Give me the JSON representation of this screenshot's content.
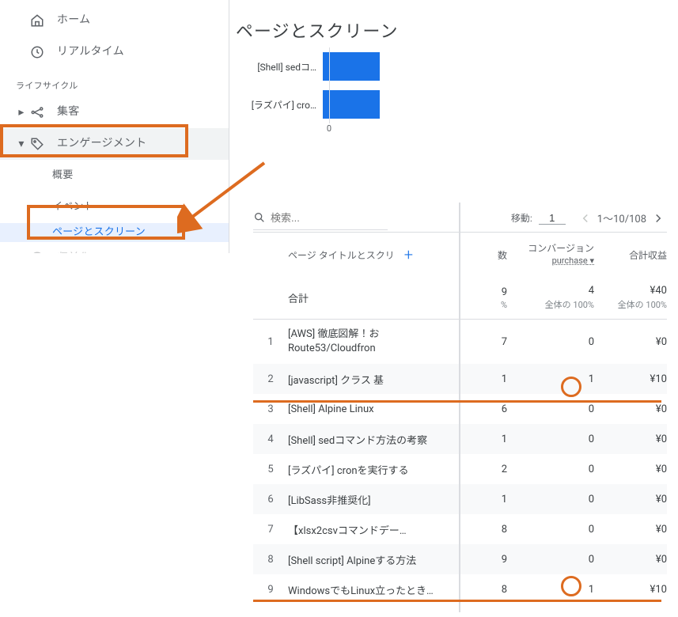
{
  "sidebar": {
    "home": "ホーム",
    "realtime": "リアルタイム",
    "lifecycle_header": "ライフサイクル",
    "acquisition": "集客",
    "engagement": "エンゲージメント",
    "engagement_items": {
      "overview": "概要",
      "events": "イベント",
      "pages_screens": "ページとスクリーン"
    },
    "monetization": "収益化"
  },
  "page_title": "ページとスクリーン",
  "chart_data": {
    "type": "bar",
    "orientation": "horizontal",
    "categories": [
      "[Shell] sedコ…",
      "[ラズパイ] cro…"
    ],
    "values": [
      9,
      9
    ],
    "xlim": [
      0,
      10
    ],
    "ticks": [
      0
    ]
  },
  "table_controls": {
    "search_placeholder": "検索...",
    "move_label": "移動:",
    "move_value": "1",
    "range_label": "1～10/108"
  },
  "table_head": {
    "title_col": "ページ タイトルとスクリ",
    "count_suffix": "数",
    "conversion": "コンバージョン",
    "conversion_sub": "purchase",
    "revenue": "合計収益"
  },
  "table_totals": {
    "label": "合計",
    "count": "9",
    "count_sub": "%",
    "conversion": "4",
    "conversion_sub": "全体の 100%",
    "revenue": "¥40",
    "revenue_sub": "全体の 100%"
  },
  "rows": [
    {
      "idx": "1",
      "title": "[AWS] 徹底図解！お Route53/Cloudfron",
      "count": "7",
      "conv": "0",
      "rev": "¥0",
      "twoline": true
    },
    {
      "idx": "2",
      "title": "[javascript] クラス 基",
      "count": "1",
      "conv": "1",
      "rev": "¥10"
    },
    {
      "idx": "3",
      "title": "[Shell] Alpine Linux",
      "count": "6",
      "conv": "0",
      "rev": "¥0"
    },
    {
      "idx": "4",
      "title": "[Shell] sedコマンド方法の考察",
      "count": "1",
      "conv": "0",
      "rev": "¥0"
    },
    {
      "idx": "5",
      "title": "[ラズパイ] cronを実行する",
      "count": "2",
      "conv": "0",
      "rev": "¥0"
    },
    {
      "idx": "6",
      "title": "[LibSass非推奨化]",
      "count": "1",
      "conv": "0",
      "rev": "¥0"
    },
    {
      "idx": "7",
      "title": "【xlsx2csvコマンドデー…",
      "count": "8",
      "conv": "0",
      "rev": "¥0"
    },
    {
      "idx": "8",
      "title": "[Shell script] Alpineする方法",
      "count": "9",
      "conv": "0",
      "rev": "¥0"
    },
    {
      "idx": "9",
      "title": "WindowsでもLinux立ったとき…",
      "count": "8",
      "conv": "1",
      "rev": "¥10"
    }
  ],
  "annotations": {
    "engagement_box": true,
    "pages_box": true,
    "arrow_to_pages": true,
    "circles_rows": [
      2,
      9
    ],
    "underline_rows": [
      2,
      9
    ]
  }
}
